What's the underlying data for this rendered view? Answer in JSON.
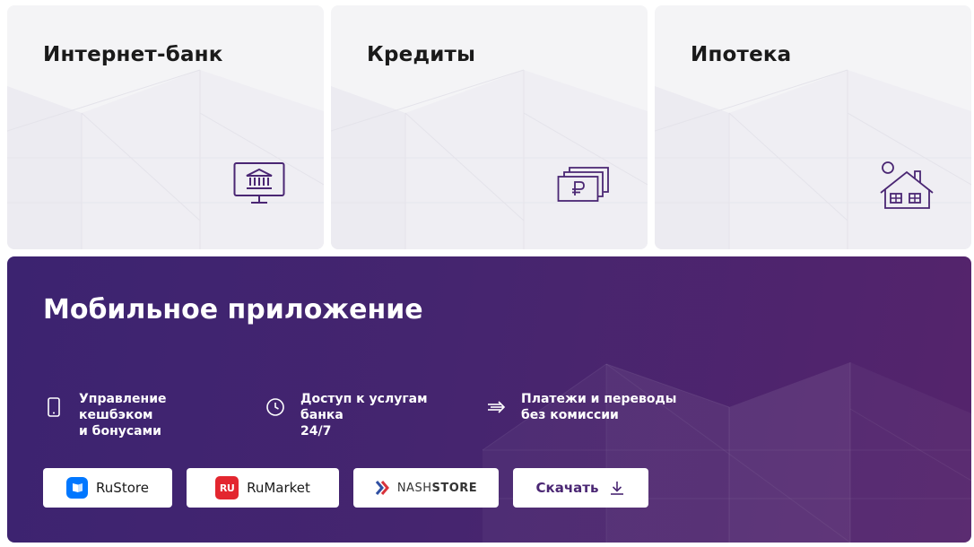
{
  "cards": [
    {
      "title": "Интернет-банк",
      "icon": "bank-monitor-icon"
    },
    {
      "title": "Кредиты",
      "icon": "ruble-banknotes-icon"
    },
    {
      "title": "Ипотека",
      "icon": "house-icon"
    }
  ],
  "mobile": {
    "title": "Мобильное приложение",
    "features": [
      {
        "icon": "smartphone-icon",
        "text": "Управление кешбэком\nи бонусами"
      },
      {
        "icon": "clock-icon",
        "text": "Доступ к услугам банка\n24/7"
      },
      {
        "icon": "transfer-arrow-icon",
        "text": "Платежи и переводы\nбез комиссии"
      }
    ],
    "stores": {
      "rustore": "RuStore",
      "rumarket": "RuMarket",
      "rumarket_logo": "RU",
      "nashstore_a": "NASH",
      "nashstore_b": "STORE",
      "download": "Скачать"
    }
  },
  "colors": {
    "card_bg": "#f4f4f6",
    "accent_purple": "#4a2673",
    "banner_start": "#3c2370",
    "banner_end": "#55246c",
    "rustore_blue": "#0077ff",
    "rumarket_red": "#e3262f"
  }
}
